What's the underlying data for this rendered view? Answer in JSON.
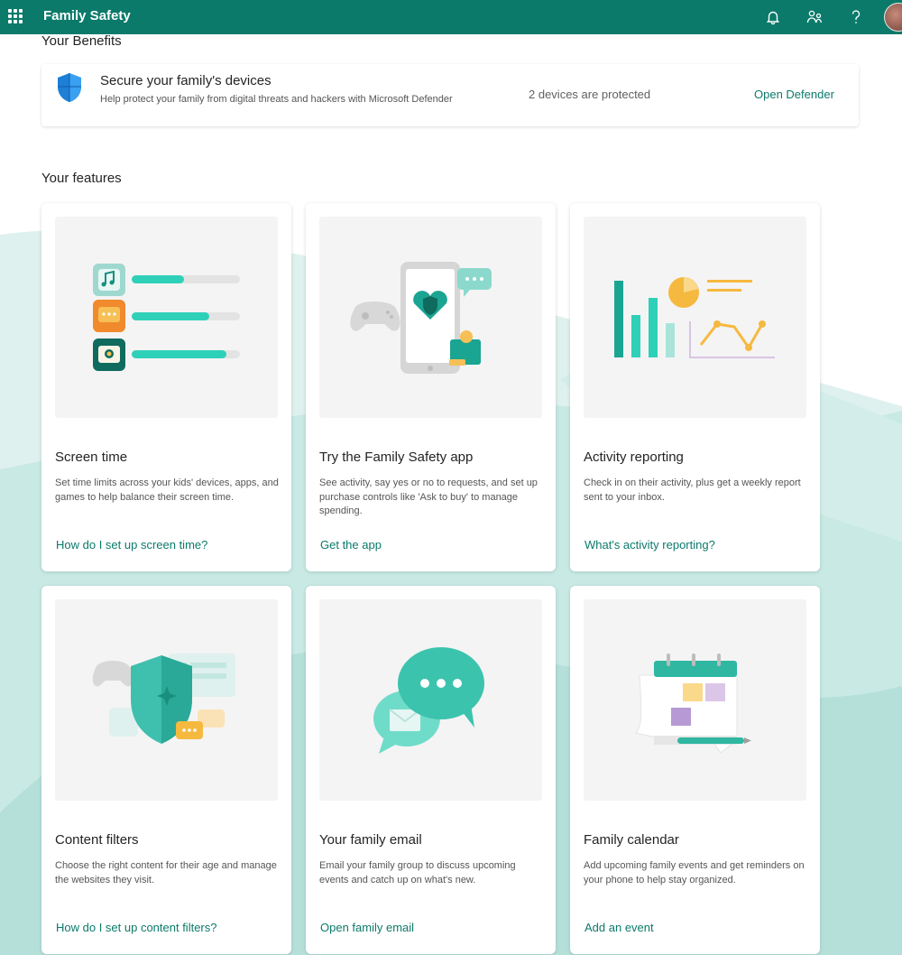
{
  "header": {
    "app_title": "Family Safety",
    "icons": [
      "waffle-menu-icon",
      "bell-icon",
      "family-icon",
      "help-icon"
    ]
  },
  "benefits": {
    "section_title": "Your Benefits",
    "card": {
      "title": "Secure your family's devices",
      "description": "Help protect your family from digital threats and hackers with Microsoft Defender",
      "status": "2 devices are protected",
      "link": "Open Defender"
    }
  },
  "features": {
    "section_title": "Your features",
    "cards": [
      {
        "title": "Screen time",
        "description": "Set time limits across your kids' devices, apps, and games to help balance their screen time.",
        "link": "How do I set up screen time?"
      },
      {
        "title": "Try the Family Safety app",
        "description": "See activity, say yes or no to requests, and set up purchase controls like 'Ask to buy' to manage spending.",
        "link": "Get the app"
      },
      {
        "title": "Activity reporting",
        "description": "Check in on their activity, plus get a weekly report sent to your inbox.",
        "link": "What's activity reporting?"
      },
      {
        "title": "Content filters",
        "description": "Choose the right content for their age and manage the websites they visit.",
        "link": "How do I set up content filters?"
      },
      {
        "title": "Your family email",
        "description": "Email your family group to discuss upcoming events and catch up on what's new.",
        "link": "Open family email"
      },
      {
        "title": "Family calendar",
        "description": "Add upcoming family events and get reminders on your phone to help stay organized.",
        "link": "Add an event"
      }
    ]
  },
  "colors": {
    "brand": "#0b7a6a",
    "accent_teal": "#2ec4b0",
    "accent_orange": "#f29b3a",
    "accent_yellow": "#f6c056"
  }
}
